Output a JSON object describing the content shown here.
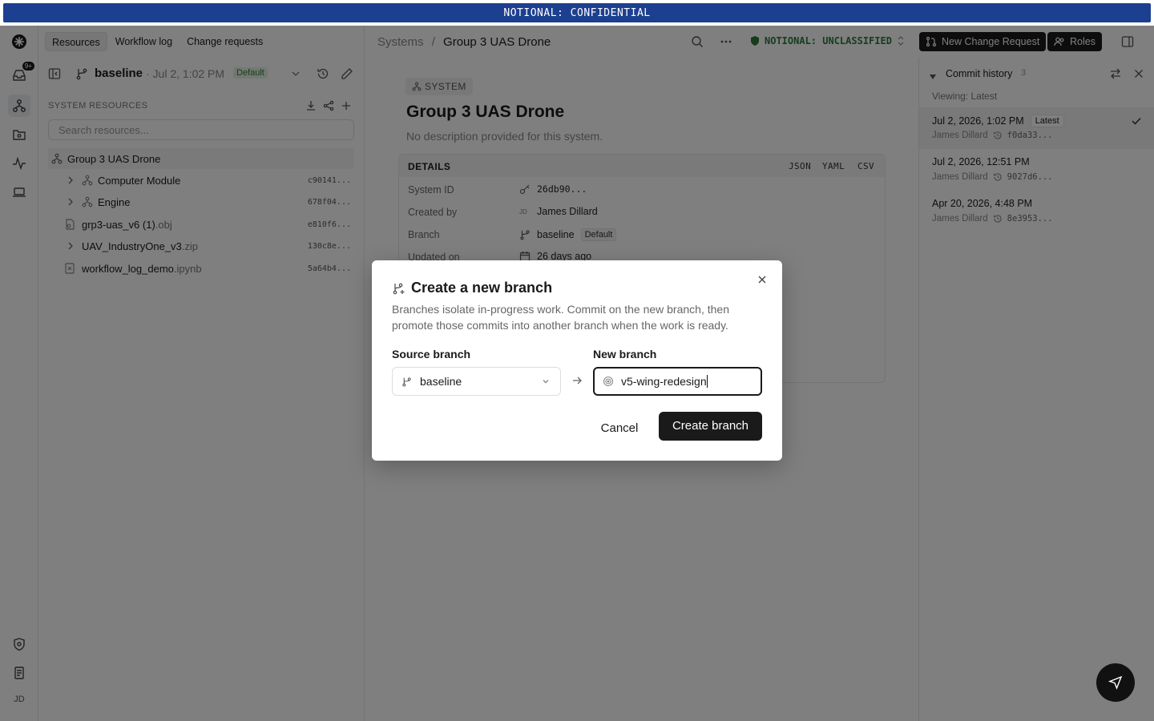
{
  "banner": {
    "text": "NOTIONAL: CONFIDENTIAL"
  },
  "rail": {
    "badge": "9+",
    "avatar": "JD"
  },
  "left": {
    "tabs": [
      {
        "label": "Resources"
      },
      {
        "label": "Workflow log"
      },
      {
        "label": "Change requests"
      }
    ],
    "branch": {
      "name": "baseline",
      "date": "· Jul 2, 1:02 PM",
      "badge": "Default"
    },
    "section_label": "SYSTEM RESOURCES",
    "search_placeholder": "Search resources...",
    "tree": [
      {
        "label": "Group 3 UAS Drone",
        "hash": ""
      },
      {
        "label": "Computer Module",
        "hash": "c90141..."
      },
      {
        "label": "Engine",
        "hash": "678f04..."
      },
      {
        "name": "grp3-uas_v6 (1)",
        "ext": ".obj",
        "hash": "e810f6..."
      },
      {
        "name": "UAV_IndustryOne_v3",
        "ext": ".zip",
        "hash": "130c8e..."
      },
      {
        "name": "workflow_log_demo",
        "ext": ".ipynb",
        "hash": "5a64b4..."
      }
    ]
  },
  "header": {
    "crumb_root": "Systems",
    "crumb_sep": "/",
    "crumb_current": "Group 3 UAS Drone",
    "classification": "NOTIONAL: UNCLASSIFIED",
    "new_cr_label": "New Change Request",
    "roles_label": "Roles"
  },
  "main": {
    "pill": "SYSTEM",
    "title": "Group 3 UAS Drone",
    "description": "No description provided for this system.",
    "details_label": "DETAILS",
    "formats": [
      "JSON",
      "YAML",
      "CSV"
    ],
    "rows": [
      {
        "label": "System ID",
        "value": "26db90..."
      },
      {
        "label": "Created by",
        "initials": "JD",
        "value": "James Dillard"
      },
      {
        "label": "Branch",
        "value": "baseline",
        "badge": "Default"
      },
      {
        "label": "Updated on",
        "value": "26 days ago"
      }
    ]
  },
  "commits": {
    "title": "Commit history",
    "count": "3",
    "viewing": "Viewing: Latest",
    "items": [
      {
        "date": "Jul 2, 2026, 1:02 PM",
        "badge": "Latest",
        "author": "James Dillard",
        "hash": "f0da33..."
      },
      {
        "date": "Jul 2, 2026, 12:51 PM",
        "author": "James Dillard",
        "hash": "9027d6..."
      },
      {
        "date": "Apr 20, 2026, 4:48 PM",
        "author": "James Dillard",
        "hash": "8e3953..."
      }
    ]
  },
  "modal": {
    "title": "Create a new branch",
    "description": "Branches isolate in-progress work. Commit on the new branch, then promote those commits into another branch when the work is ready.",
    "source_label": "Source branch",
    "source_value": "baseline",
    "new_label": "New branch",
    "new_value": "v5-wing-redesign",
    "cancel": "Cancel",
    "create": "Create branch"
  }
}
